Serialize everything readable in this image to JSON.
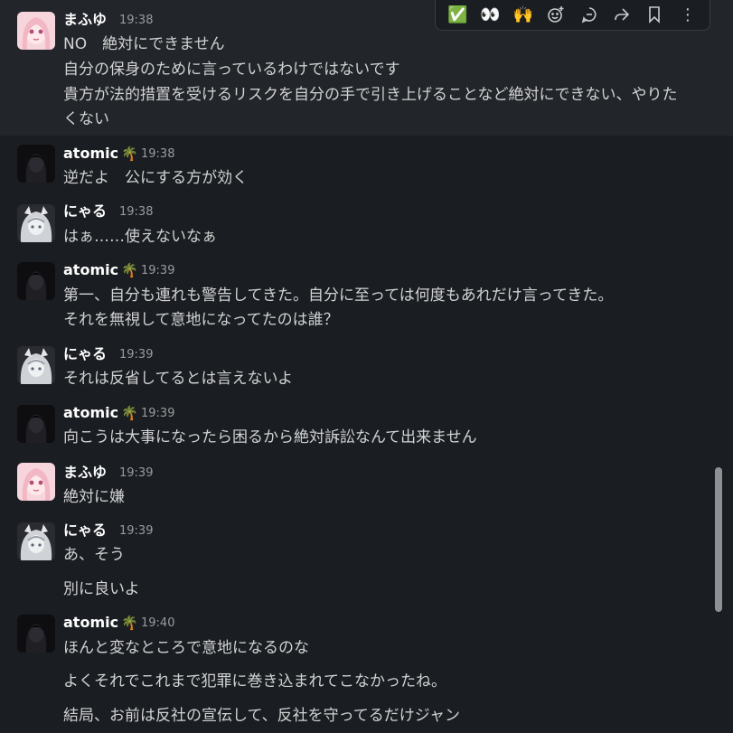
{
  "toolbar": {
    "buttons": [
      {
        "icon": "check-mark-emoji-icon",
        "glyph": "✅"
      },
      {
        "icon": "eyes-emoji-icon",
        "glyph": "👀"
      },
      {
        "icon": "raised-hands-emoji-icon",
        "glyph": "🙌"
      },
      {
        "icon": "add-reaction-icon"
      },
      {
        "icon": "reply-in-thread-icon"
      },
      {
        "icon": "share-message-icon"
      },
      {
        "icon": "save-bookmark-icon"
      },
      {
        "icon": "more-actions-icon",
        "glyph": "⋮"
      }
    ]
  },
  "messages": [
    {
      "author": "まふゆ",
      "time": "19:38",
      "lines": [
        "NO　絶対にできません",
        "自分の保身のために言っているわけではないです",
        "貴方が法的措置を受けるリスクを自分の手で引き上げることなど絶対にできない、やりた",
        "くない"
      ]
    },
    {
      "author": "atomic",
      "badge": "🌴",
      "time": "19:38",
      "lines": [
        "逆だよ　公にする方が効く"
      ]
    },
    {
      "author": "にゃる",
      "time": "19:38",
      "lines": [
        "はぁ……使えないなぁ"
      ]
    },
    {
      "author": "atomic",
      "badge": "🌴",
      "time": "19:39",
      "lines": [
        "第一、自分も連れも警告してきた。自分に至っては何度もあれだけ言ってきた。",
        "それを無視して意地になってたのは誰？"
      ]
    },
    {
      "author": "にゃる",
      "time": "19:39",
      "lines": [
        "それは反省してるとは言えないよ"
      ]
    },
    {
      "author": "atomic",
      "badge": "🌴",
      "time": "19:39",
      "lines": [
        "向こうは大事になったら困るから絶対訴訟なんて出来ません"
      ]
    },
    {
      "author": "まふゆ",
      "time": "19:39",
      "lines": [
        "絶対に嫌"
      ]
    },
    {
      "author": "にゃる",
      "time": "19:39",
      "lines": [
        "あ、そう"
      ]
    },
    {
      "continuation": true,
      "lines": [
        "別に良いよ"
      ]
    },
    {
      "author": "atomic",
      "badge": "🌴",
      "time": "19:40",
      "lines": [
        "ほんと変なところで意地になるのな"
      ]
    },
    {
      "continuation": true,
      "lines": [
        "よくそれでこれまで犯罪に巻き込まれてこなかったね。"
      ]
    },
    {
      "continuation": true,
      "lines": [
        "結局、お前は反社の宣伝して、反社を守ってるだけジャン"
      ]
    }
  ]
}
